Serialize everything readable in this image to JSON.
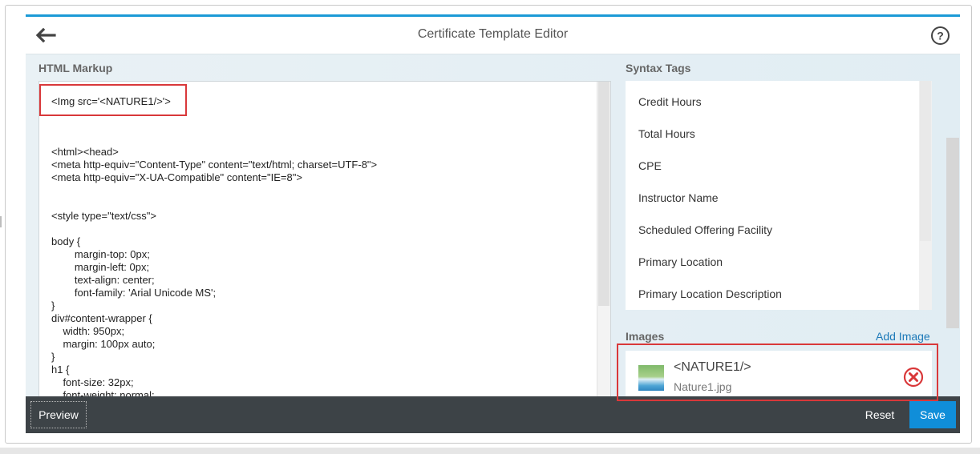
{
  "dialog": {
    "title": "Certificate Template Editor"
  },
  "markup": {
    "label": "HTML Markup",
    "lines": [
      {
        "text": "<Img src='<NATURE1/>'>"
      },
      {
        "text": "<html><head>"
      },
      {
        "text": "<meta http-equiv=\"Content-Type\" content=\"text/html; charset=UTF-8\">"
      },
      {
        "text": "<meta http-equiv=\"X-UA-Compatible\" content=\"IE=8\">"
      },
      {
        "text": "<style type=\"text/css\">"
      },
      {
        "text": "body {"
      },
      {
        "text": "        margin-top: 0px;"
      },
      {
        "text": "        margin-left: 0px;"
      },
      {
        "text": "        text-align: center;"
      },
      {
        "text": "        font-family: 'Arial Unicode MS';"
      },
      {
        "text": "}"
      },
      {
        "text": "div#content-wrapper {"
      },
      {
        "text": "    width: 950px;"
      },
      {
        "text": "    margin: 100px auto;"
      },
      {
        "text": "}"
      },
      {
        "text": "h1 {"
      },
      {
        "text": "    font-size: 32px;"
      },
      {
        "text": "    font-weight: normal;"
      }
    ]
  },
  "syntax_tags": {
    "label": "Syntax Tags",
    "items": [
      "Credit Hours",
      "Total Hours",
      "CPE",
      "Instructor Name",
      "Scheduled Offering Facility",
      "Primary Location",
      "Primary Location Description"
    ]
  },
  "images": {
    "label": "Images",
    "add_label": "Add Image",
    "items": [
      {
        "tag": "<NATURE1/>",
        "file": "Nature1.jpg",
        "thumb_icon": "nature-thumbnail-icon"
      }
    ]
  },
  "footer": {
    "preview_label": "Preview",
    "reset_label": "Reset",
    "save_label": "Save"
  },
  "colors": {
    "accent": "#1b9ad6",
    "save": "#108ed9",
    "footer": "#3d4347",
    "highlight": "#d9383a",
    "remove": "#d9383a"
  }
}
